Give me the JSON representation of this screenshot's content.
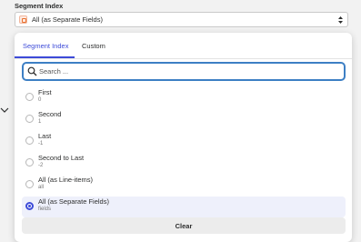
{
  "field": {
    "label": "Segment Index",
    "value": "All (as Separate Fields)"
  },
  "tabs": [
    {
      "label": "Segment Index",
      "active": true
    },
    {
      "label": "Custom",
      "active": false
    }
  ],
  "search": {
    "placeholder": "Search ...",
    "value": ""
  },
  "options": [
    {
      "label": "First",
      "sub": "0",
      "selected": false
    },
    {
      "label": "Second",
      "sub": "1",
      "selected": false
    },
    {
      "label": "Last",
      "sub": "-1",
      "selected": false
    },
    {
      "label": "Second to Last",
      "sub": "-2",
      "selected": false
    },
    {
      "label": "All (as Line-items)",
      "sub": "all",
      "selected": false
    },
    {
      "label": "All (as Separate Fields)",
      "sub": "fields",
      "selected": true
    }
  ],
  "clear_label": "Clear",
  "colors": {
    "accent": "#3d4bd8",
    "search_border": "#3d7fc4",
    "selected_bg": "#eef0fb",
    "app_icon": "#e8712f"
  },
  "icons": {
    "app": "formatter-app-icon",
    "sort": "sort-arrows-icon",
    "search": "search-icon",
    "collapse": "chevron-down-icon"
  }
}
